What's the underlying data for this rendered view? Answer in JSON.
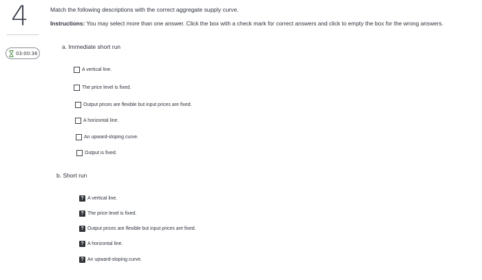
{
  "question": {
    "number": "4",
    "prompt": "Match the following descriptions with the correct aggregate supply curve.",
    "instructions_bold": "Instructions:",
    "instructions_text": " You may select more than one answer. Click the box with a check mark for correct answers and click to empty the box for the wrong answers.",
    "timer": "03:00:36"
  },
  "part_a": {
    "label": "a. Immediate short run",
    "options": [
      "A vertical line.",
      "The price level is fixed.",
      "Output prices are flexible but input prices are fixed.",
      "A horizontal line.",
      "An upward-sloping curve.",
      "Output is fixed."
    ]
  },
  "part_b": {
    "label": "b. Short run",
    "help_glyph": "?",
    "options": [
      "A vertical line.",
      "The price level is fixed.",
      "Output prices are flexible but input prices are fixed.",
      "A horizontal line.",
      "An upward-sloping curve."
    ]
  }
}
